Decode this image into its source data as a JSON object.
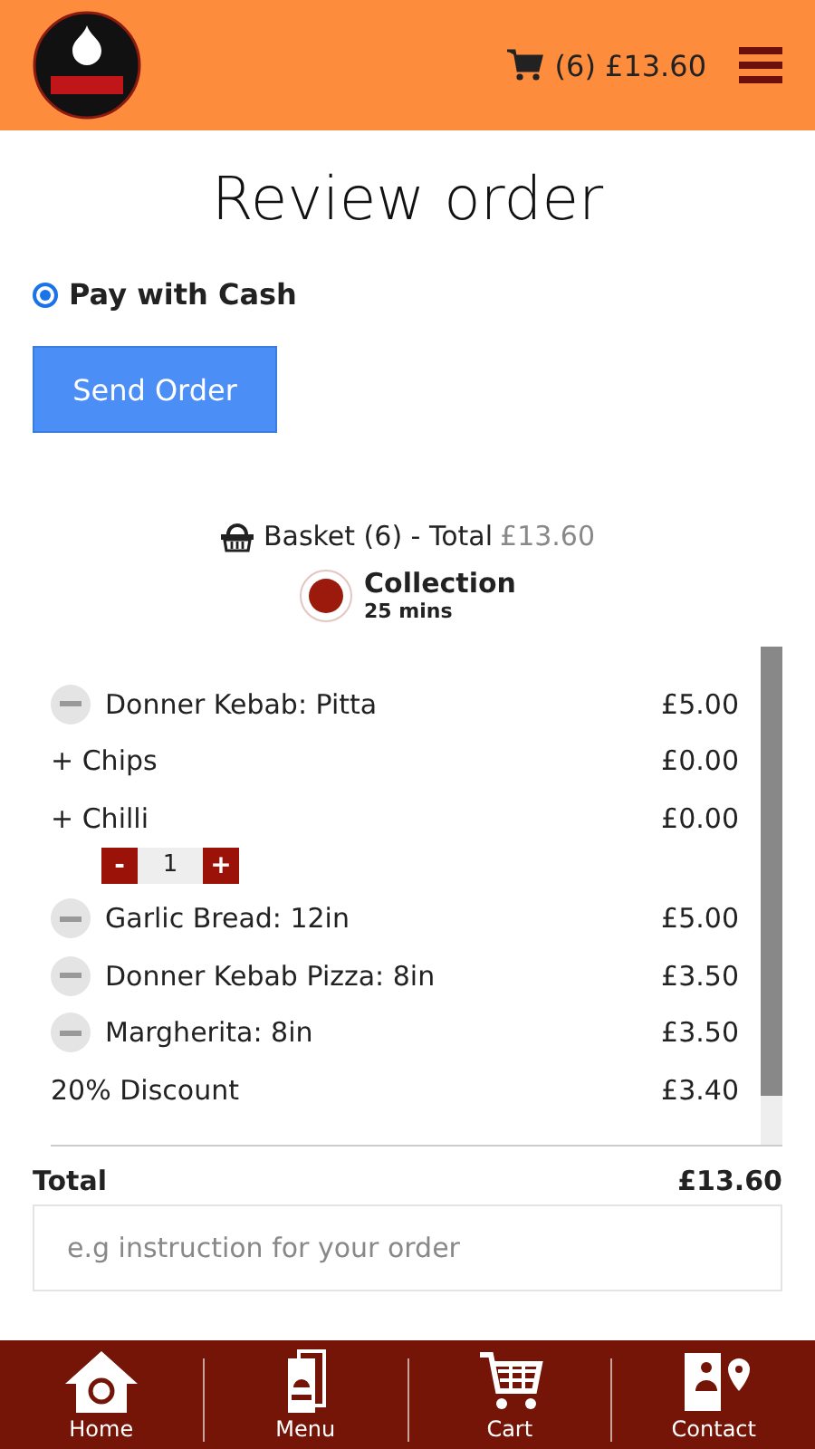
{
  "header": {
    "cart_summary": "(6) £13.60"
  },
  "title": "Review order",
  "payment": {
    "label": "Pay with Cash",
    "checked": true
  },
  "send_button": "Send Order",
  "basket": {
    "label": "Basket (6) - Total",
    "total": "£13.60"
  },
  "collection": {
    "label": "Collection",
    "time": "25 mins"
  },
  "items": [
    {
      "kind": "item",
      "name": "Donner Kebab: Pitta",
      "price": "£5.00"
    },
    {
      "kind": "extra",
      "name": "+ Chips",
      "price": "£0.00"
    },
    {
      "kind": "extra",
      "name": "+ Chilli",
      "price": "£0.00"
    },
    {
      "kind": "qty",
      "minus": "-",
      "value": "1",
      "plus": "+"
    },
    {
      "kind": "item",
      "name": "Garlic Bread: 12in",
      "price": "£5.00"
    },
    {
      "kind": "item",
      "name": "Donner Kebab Pizza: 8in",
      "price": "£3.50"
    },
    {
      "kind": "item",
      "name": "Margherita: 8in",
      "price": "£3.50"
    },
    {
      "kind": "extra",
      "name": "20% Discount",
      "price": "£3.40"
    }
  ],
  "total": {
    "label": "Total",
    "value": "£13.60"
  },
  "instructions": {
    "placeholder": "e.g instruction for your order"
  },
  "nav": [
    {
      "kind": "home",
      "label": "Home"
    },
    {
      "kind": "menu",
      "label": "Menu"
    },
    {
      "kind": "cart",
      "label": "Cart"
    },
    {
      "kind": "contact",
      "label": "Contact"
    }
  ]
}
